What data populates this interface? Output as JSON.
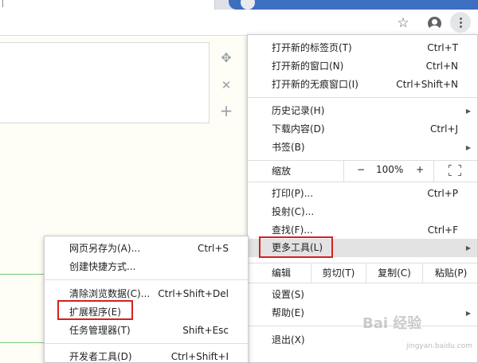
{
  "toolbar": {
    "star_icon": "☆",
    "account_icon": "account-circle-icon",
    "menu_icon": "vertical-dots-icon"
  },
  "content": {
    "side_tools": [
      "move-icon",
      "close-icon",
      "plus-icon"
    ],
    "move_glyph": "✥",
    "close_glyph": "✕",
    "plus_glyph": "+",
    "watermark": "Bai 经验",
    "watermark_sub": "jingyan.baidu.com"
  },
  "main_menu": {
    "group1": [
      {
        "label": "打开新的标签页(T)",
        "shortcut": "Ctrl+T"
      },
      {
        "label": "打开新的窗口(N)",
        "shortcut": "Ctrl+N"
      },
      {
        "label": "打开新的无痕窗口(I)",
        "shortcut": "Ctrl+Shift+N"
      }
    ],
    "group2": [
      {
        "label": "历史记录(H)",
        "shortcut": "",
        "arrow": "▶"
      },
      {
        "label": "下载内容(D)",
        "shortcut": "Ctrl+J"
      },
      {
        "label": "书签(B)",
        "shortcut": "",
        "arrow": "▶"
      }
    ],
    "zoom": {
      "label": "缩放",
      "minus": "−",
      "value": "100%",
      "plus": "+"
    },
    "group3": [
      {
        "label": "打印(P)...",
        "shortcut": "Ctrl+P"
      },
      {
        "label": "投射(C)...",
        "shortcut": ""
      },
      {
        "label": "查找(F)...",
        "shortcut": "Ctrl+F"
      },
      {
        "label": "更多工具(L)",
        "shortcut": "",
        "arrow": "▶"
      }
    ],
    "edit": {
      "label": "编辑",
      "cut": "剪切(T)",
      "copy": "复制(C)",
      "paste": "粘贴(P)"
    },
    "group4": [
      {
        "label": "设置(S)",
        "shortcut": ""
      },
      {
        "label": "帮助(E)",
        "shortcut": "",
        "arrow": "▶"
      }
    ],
    "exit": {
      "label": "退出(X)"
    }
  },
  "sub_menu": {
    "group1": [
      {
        "label": "网页另存为(A)...",
        "shortcut": "Ctrl+S"
      },
      {
        "label": "创建快捷方式...",
        "shortcut": ""
      }
    ],
    "group2": [
      {
        "label": "清除浏览数据(C)...",
        "shortcut": "Ctrl+Shift+Del"
      },
      {
        "label": "扩展程序(E)",
        "shortcut": ""
      },
      {
        "label": "任务管理器(T)",
        "shortcut": "Shift+Esc"
      }
    ],
    "group3": [
      {
        "label": "开发者工具(D)",
        "shortcut": "Ctrl+Shift+I"
      }
    ]
  }
}
